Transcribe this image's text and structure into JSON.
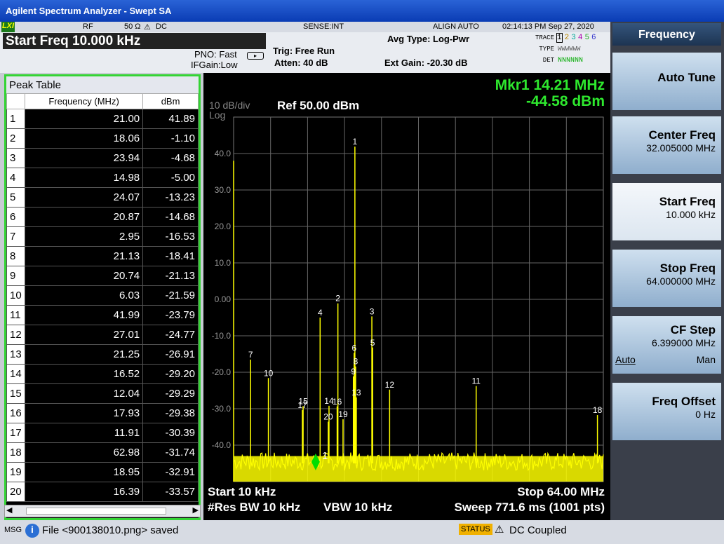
{
  "window": {
    "title": "Agilent Spectrum Analyzer - Swept SA"
  },
  "status": {
    "rf": "RF",
    "impedance": "50 Ω",
    "warn": "DC",
    "sense": "SENSE:INT",
    "align": "ALIGN AUTO",
    "timestamp": "02:14:13 PM Sep 27, 2020"
  },
  "info": {
    "start_freq": "Start Freq 10.000 kHz",
    "pno": "PNO: Fast",
    "ifgain": "IFGain:Low",
    "trig": "Trig: Free Run",
    "atten": "Atten: 40 dB",
    "avg_type": "Avg Type: Log-Pwr",
    "ext_gain": "Ext Gain: -20.30 dB",
    "trace_label": "TRACE",
    "type_label": "TYPE",
    "det_label": "DET",
    "trace_nums": [
      "1",
      "2",
      "3",
      "4",
      "5",
      "6"
    ],
    "type_val": "WWWWWW",
    "det_val": "NNNNNN"
  },
  "peak_table": {
    "title": "Peak Table",
    "col_freq": "Frequency (MHz)",
    "col_db": "dBm",
    "rows": [
      {
        "n": "1",
        "f": "21.00",
        "d": "41.89"
      },
      {
        "n": "2",
        "f": "18.06",
        "d": "-1.10"
      },
      {
        "n": "3",
        "f": "23.94",
        "d": "-4.68"
      },
      {
        "n": "4",
        "f": "14.98",
        "d": "-5.00"
      },
      {
        "n": "5",
        "f": "24.07",
        "d": "-13.23"
      },
      {
        "n": "6",
        "f": "20.87",
        "d": "-14.68"
      },
      {
        "n": "7",
        "f": "2.95",
        "d": "-16.53"
      },
      {
        "n": "8",
        "f": "21.13",
        "d": "-18.41"
      },
      {
        "n": "9",
        "f": "20.74",
        "d": "-21.13"
      },
      {
        "n": "10",
        "f": "6.03",
        "d": "-21.59"
      },
      {
        "n": "11",
        "f": "41.99",
        "d": "-23.79"
      },
      {
        "n": "12",
        "f": "27.01",
        "d": "-24.77"
      },
      {
        "n": "13",
        "f": "21.25",
        "d": "-26.91"
      },
      {
        "n": "14",
        "f": "16.52",
        "d": "-29.20"
      },
      {
        "n": "15",
        "f": "12.04",
        "d": "-29.29"
      },
      {
        "n": "16",
        "f": "17.93",
        "d": "-29.38"
      },
      {
        "n": "17",
        "f": "11.91",
        "d": "-30.39"
      },
      {
        "n": "18",
        "f": "62.98",
        "d": "-31.74"
      },
      {
        "n": "19",
        "f": "18.95",
        "d": "-32.91"
      },
      {
        "n": "20",
        "f": "16.39",
        "d": "-33.57"
      }
    ]
  },
  "plot": {
    "scale": "10 dB/div",
    "log": "Log",
    "ref": "Ref 50.00 dBm",
    "mkr_freq": "Mkr1 14.21 MHz",
    "mkr_amp": "-44.58 dBm",
    "marker_label": "1",
    "start": "Start 10 kHz",
    "stop": "Stop 64.00 MHz",
    "rbw": "#Res BW 10 kHz",
    "vbw": "VBW 10 kHz",
    "sweep": "Sweep  771.6 ms (1001 pts)",
    "y_ticks": [
      "40.0",
      "30.0",
      "20.0",
      "10.0",
      "0.00",
      "-10.0",
      "-20.0",
      "-30.0",
      "-40.0"
    ],
    "trace_color": "#ffff00",
    "marker_color": "#00dd00"
  },
  "chart_data": {
    "type": "line",
    "x_unit": "MHz",
    "y_unit": "dBm",
    "xlim": [
      0.01,
      64.0
    ],
    "ylim": [
      -50,
      50
    ],
    "noise_floor": -45,
    "peaks": [
      {
        "label": "1",
        "x": 21.0,
        "y": 41.89
      },
      {
        "label": "2",
        "x": 18.06,
        "y": -1.1
      },
      {
        "label": "3",
        "x": 23.94,
        "y": -4.68
      },
      {
        "label": "4",
        "x": 14.98,
        "y": -5.0
      },
      {
        "label": "5",
        "x": 24.07,
        "y": -13.23
      },
      {
        "label": "6",
        "x": 20.87,
        "y": -14.68
      },
      {
        "label": "7",
        "x": 2.95,
        "y": -16.53
      },
      {
        "label": "8",
        "x": 21.13,
        "y": -18.41
      },
      {
        "label": "9",
        "x": 20.74,
        "y": -21.13
      },
      {
        "label": "10",
        "x": 6.03,
        "y": -21.59
      },
      {
        "label": "11",
        "x": 41.99,
        "y": -23.79
      },
      {
        "label": "12",
        "x": 27.01,
        "y": -24.77
      },
      {
        "label": "13",
        "x": 21.25,
        "y": -26.91
      },
      {
        "label": "14",
        "x": 16.52,
        "y": -29.2
      },
      {
        "label": "15",
        "x": 12.04,
        "y": -29.29
      },
      {
        "label": "16",
        "x": 17.93,
        "y": -29.38
      },
      {
        "label": "17",
        "x": 11.91,
        "y": -30.39
      },
      {
        "label": "18",
        "x": 62.98,
        "y": -31.74
      },
      {
        "label": "19",
        "x": 18.95,
        "y": -32.91
      },
      {
        "label": "20",
        "x": 16.39,
        "y": -33.57
      }
    ],
    "marker": {
      "x": 14.21,
      "y": -44.58
    }
  },
  "softkeys": {
    "title": "Frequency",
    "auto_tune": "Auto Tune",
    "center": "Center Freq",
    "center_val": "32.005000 MHz",
    "start": "Start Freq",
    "start_val": "10.000 kHz",
    "stop": "Stop Freq",
    "stop_val": "64.000000 MHz",
    "cf_step": "CF Step",
    "cf_step_val": "6.399000 MHz",
    "auto": "Auto",
    "man": "Man",
    "offset": "Freq Offset",
    "offset_val": "0 Hz"
  },
  "bottom": {
    "msg": "MSG",
    "file_msg": "File <900138010.png> saved",
    "status": "STATUS",
    "coupled": "DC Coupled"
  }
}
